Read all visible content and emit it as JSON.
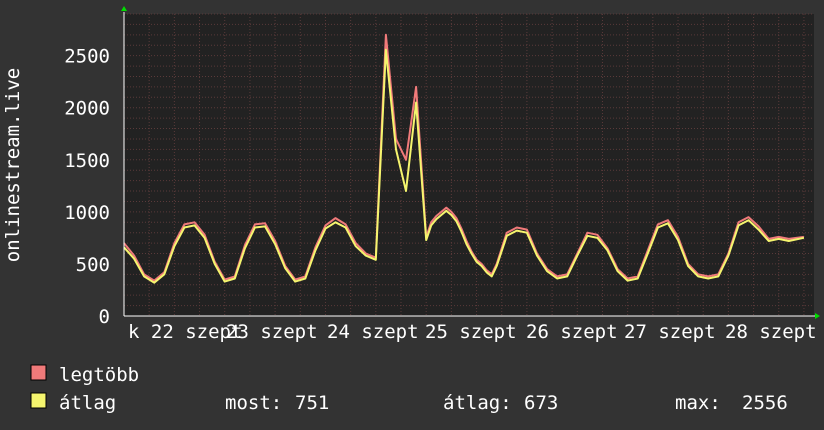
{
  "chart_data": {
    "type": "line",
    "ylabel": "onlinestream.live",
    "ylim": [
      0,
      2900
    ],
    "yticks": [
      0,
      500,
      1000,
      1500,
      2000,
      2500
    ],
    "x_tick_labels": [
      "k 22 szept",
      "23 szept",
      "24 szept",
      "25 szept",
      "26 szept",
      "27 szept",
      "28 szept"
    ],
    "grid": true,
    "colors": {
      "background": "#333333",
      "plot": "#222222",
      "grid": "#5a3a3a",
      "axis": "#ffffff",
      "arrow": "#00dd00"
    },
    "series": [
      {
        "name": "legtöbb",
        "color": "#f07a7a",
        "x": [
          0,
          0.1,
          0.2,
          0.3,
          0.4,
          0.5,
          0.6,
          0.7,
          0.8,
          0.9,
          1,
          1.1,
          1.2,
          1.3,
          1.4,
          1.5,
          1.6,
          1.7,
          1.8,
          1.9,
          2,
          2.1,
          2.2,
          2.3,
          2.4,
          2.5,
          2.6,
          2.7,
          2.8,
          2.9,
          3,
          3.05,
          3.1,
          3.15,
          3.2,
          3.25,
          3.3,
          3.35,
          3.4,
          3.45,
          3.5,
          3.55,
          3.6,
          3.65,
          3.7,
          3.8,
          3.9,
          4,
          4.1,
          4.2,
          4.3,
          4.4,
          4.5,
          4.6,
          4.7,
          4.8,
          4.9,
          5,
          5.1,
          5.2,
          5.3,
          5.4,
          5.5,
          5.6,
          5.7,
          5.8,
          5.9,
          6,
          6.1,
          6.2,
          6.3,
          6.4,
          6.5,
          6.6,
          6.75
        ],
        "values": [
          700,
          580,
          400,
          340,
          420,
          700,
          880,
          900,
          780,
          520,
          350,
          380,
          680,
          880,
          890,
          720,
          480,
          350,
          380,
          660,
          870,
          940,
          880,
          700,
          600,
          560,
          2700,
          1700,
          1500,
          2200,
          760,
          900,
          960,
          1000,
          1040,
          1000,
          940,
          840,
          720,
          620,
          540,
          500,
          440,
          400,
          500,
          800,
          850,
          830,
          600,
          450,
          380,
          400,
          600,
          800,
          780,
          650,
          450,
          360,
          380,
          630,
          880,
          920,
          760,
          500,
          400,
          380,
          400,
          600,
          900,
          950,
          860,
          740,
          760,
          740,
          760
        ]
      },
      {
        "name": "átlag",
        "color": "#f5f56e",
        "x": [
          0,
          0.1,
          0.2,
          0.3,
          0.4,
          0.5,
          0.6,
          0.7,
          0.8,
          0.9,
          1,
          1.1,
          1.2,
          1.3,
          1.4,
          1.5,
          1.6,
          1.7,
          1.8,
          1.9,
          2,
          2.1,
          2.2,
          2.3,
          2.4,
          2.5,
          2.6,
          2.7,
          2.8,
          2.9,
          3,
          3.05,
          3.1,
          3.15,
          3.2,
          3.25,
          3.3,
          3.35,
          3.4,
          3.45,
          3.5,
          3.55,
          3.6,
          3.65,
          3.7,
          3.8,
          3.9,
          4,
          4.1,
          4.2,
          4.3,
          4.4,
          4.5,
          4.6,
          4.7,
          4.8,
          4.9,
          5,
          5.1,
          5.2,
          5.3,
          5.4,
          5.5,
          5.6,
          5.7,
          5.8,
          5.9,
          6,
          6.1,
          6.2,
          6.3,
          6.4,
          6.5,
          6.6,
          6.75
        ],
        "values": [
          660,
          550,
          380,
          320,
          400,
          670,
          850,
          870,
          750,
          500,
          330,
          360,
          650,
          850,
          860,
          690,
          460,
          330,
          360,
          630,
          840,
          900,
          850,
          670,
          580,
          540,
          2556,
          1600,
          1200,
          2050,
          730,
          870,
          930,
          970,
          1010,
          970,
          910,
          810,
          690,
          600,
          520,
          480,
          420,
          380,
          480,
          770,
          820,
          800,
          580,
          430,
          360,
          380,
          580,
          770,
          750,
          630,
          430,
          340,
          360,
          600,
          850,
          890,
          730,
          480,
          380,
          360,
          380,
          580,
          870,
          920,
          830,
          720,
          740,
          720,
          751
        ]
      }
    ],
    "stats": {
      "now_label": "most:",
      "now_value": "751",
      "avg_label": "átlag:",
      "avg_value": "673",
      "max_label": "max:",
      "max_value": "2556"
    }
  }
}
